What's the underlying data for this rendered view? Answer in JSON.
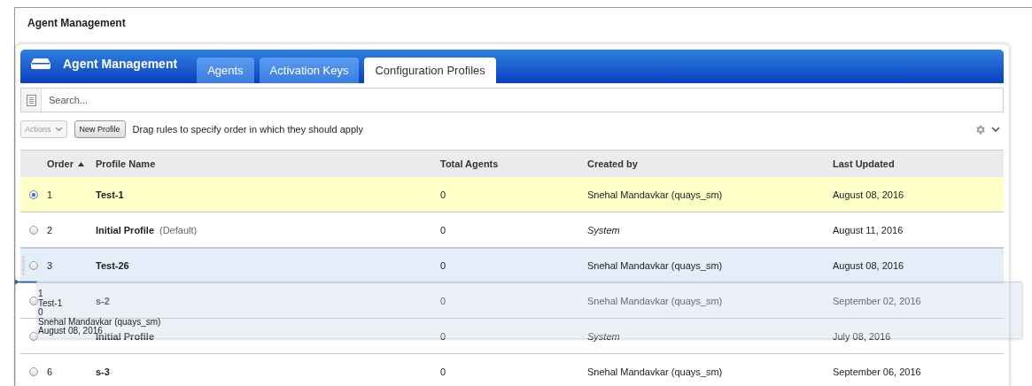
{
  "page_title": "Agent Management",
  "header": {
    "title": "Agent Management"
  },
  "tabs": [
    {
      "label": "Agents",
      "selected": false
    },
    {
      "label": "Activation Keys",
      "selected": false
    },
    {
      "label": "Configuration Profiles",
      "selected": true
    }
  ],
  "search": {
    "placeholder": "Search..."
  },
  "toolbar": {
    "actions_label": "Actions",
    "actions_disabled": true,
    "new_button": "New Profile",
    "hint": "Drag rules to specify order in which they should apply"
  },
  "table": {
    "columns": [
      "",
      "Order",
      "Profile Name",
      "Total Agents",
      "Created by",
      "Last Updated"
    ],
    "rows": [
      {
        "selected": true,
        "dragging": false,
        "order": "1",
        "name": "Test-1",
        "total_agents": "0",
        "created_by": "Snehal Mandavkar (quays_sm)",
        "system": false,
        "last_updated": "August 08, 2016"
      },
      {
        "selected": false,
        "dragging": false,
        "order": "2",
        "name": "Initial Profile",
        "tag": "(Default)",
        "total_agents": "0",
        "created_by": "System",
        "system": true,
        "last_updated": "August 11, 2016"
      },
      {
        "selected": false,
        "dragging": true,
        "order": "3",
        "name": "Test-26",
        "total_agents": "0",
        "created_by": "Snehal Mandavkar (quays_sm)",
        "system": false,
        "last_updated": "August 08, 2016"
      },
      {
        "selected": false,
        "dragging": false,
        "name": "s-2",
        "total_agents": "0",
        "created_by": "Snehal Mandavkar (quays_sm)",
        "system": false,
        "last_updated": "September 02, 2016"
      },
      {
        "selected": false,
        "dragging": false,
        "name": "Initial Profile",
        "total_agents": "0",
        "created_by": "System",
        "system": true,
        "last_updated": "July 08, 2016"
      },
      {
        "selected": false,
        "dragging": false,
        "order": "6",
        "name": "s-3",
        "total_agents": "0",
        "created_by": "Snehal Mandavkar (quays_sm)",
        "system": false,
        "last_updated": "September 06, 2016"
      }
    ]
  },
  "drag_preview": {
    "lines": [
      "1",
      "Test-1",
      "0",
      "Snehal Mandavkar (quays_sm)",
      "August 08, 2016"
    ]
  }
}
